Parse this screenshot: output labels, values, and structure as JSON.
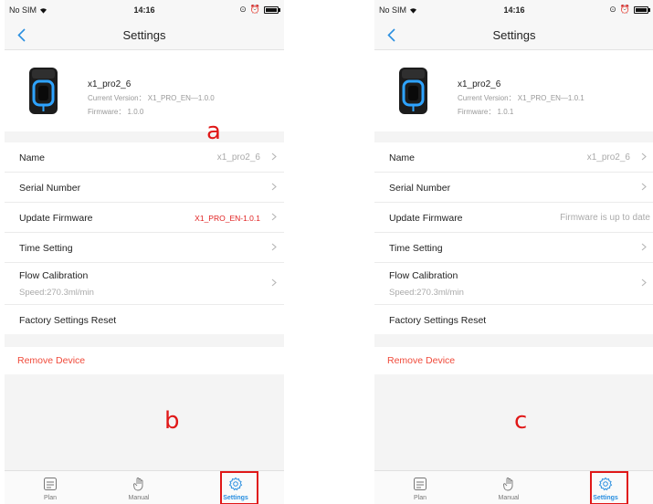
{
  "left": {
    "status": {
      "carrier": "No SIM",
      "time": "14:16"
    },
    "nav_title": "Settings",
    "device": {
      "name": "x1_pro2_6",
      "version": "Current Version： X1_PRO_EN—1.0.0",
      "firmware": "Firmware： 1.0.0"
    },
    "rows": {
      "name_label": "Name",
      "name_value": "x1_pro2_6",
      "serial_label": "Serial Number",
      "update_label": "Update Firmware",
      "update_value": "X1_PRO_EN-1.0.1",
      "time_label": "Time Setting",
      "flow_label": "Flow Calibration",
      "flow_sub": "Speed:270.3ml/min",
      "reset_label": "Factory Settings Reset"
    },
    "remove_label": "Remove Device",
    "tabs": {
      "plan": "Plan",
      "manual": "Manual",
      "settings": "Settings"
    },
    "callouts": {
      "a": "a",
      "b": "b"
    }
  },
  "right": {
    "status": {
      "carrier": "No SIM",
      "time": "14:16"
    },
    "nav_title": "Settings",
    "device": {
      "name": "x1_pro2_6",
      "version": "Current Version： X1_PRO_EN—1.0.1",
      "firmware": "Firmware： 1.0.1"
    },
    "rows": {
      "name_label": "Name",
      "name_value": "x1_pro2_6",
      "serial_label": "Serial Number",
      "update_label": "Update Firmware",
      "update_value": "Firmware is up to date",
      "time_label": "Time Setting",
      "flow_label": "Flow Calibration",
      "flow_sub": "Speed:270.3ml/min",
      "reset_label": "Factory Settings Reset"
    },
    "remove_label": "Remove Device",
    "tabs": {
      "plan": "Plan",
      "manual": "Manual",
      "settings": "Settings"
    },
    "callouts": {
      "c": "c"
    }
  },
  "colors": {
    "accent": "#2a8fe0",
    "danger": "#f04a3a",
    "callout": "#e01818"
  },
  "icons": [
    "wifi-icon",
    "alarm-icon",
    "battery-icon",
    "back-arrow-icon",
    "chevron-right-icon",
    "plan-icon",
    "manual-hand-icon",
    "settings-gear-icon"
  ]
}
